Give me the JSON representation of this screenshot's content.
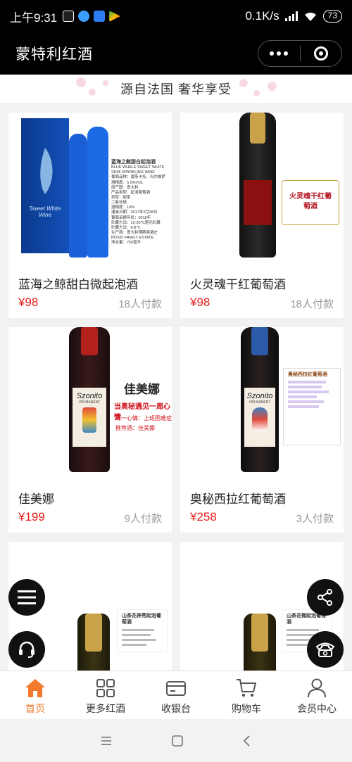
{
  "status": {
    "time": "上午9:31",
    "net": "0.1K/s",
    "battery": "73"
  },
  "navbar": {
    "title": "蒙特利红酒"
  },
  "banner": {
    "text": "源自法国 奢华享受"
  },
  "products": [
    {
      "name": "蓝海之鲸甜白微起泡酒",
      "price": "¥98",
      "sold": "18人付款"
    },
    {
      "name": "火灵魂干红葡萄酒",
      "price": "¥98",
      "sold": "18人付款"
    },
    {
      "name": "佳美娜",
      "price": "¥199",
      "sold": "9人付款"
    },
    {
      "name": "奥秘西拉红葡萄酒",
      "price": "¥258",
      "sold": "3人付款"
    },
    {
      "name": "",
      "price": "",
      "sold": ""
    },
    {
      "name": "",
      "price": "",
      "sold": ""
    }
  ],
  "image_text": {
    "p1_label_title": "蓝海之鲸甜白起泡酒",
    "p1_label_sub1": "BLUE WHALE SWEET WHITE",
    "p1_label_sub2": "SEMI SPARKLING WINE",
    "p1_label_lines": [
      "葡萄品种：莫斯卡托、玛尔维萨",
      "酒精度：5.0%VOL",
      "原产国：意大利",
      "产品类型：起泡葡萄酒",
      "类型：甜型",
      "二氧化硫",
      "酒精度：10%",
      "灌装日期：2017年2月28日",
      "葡萄采摘年份：2015年",
      "贮藏方法：12-20℃避光贮藏",
      "贮藏方法：6-8℃",
      "生产商：意大利博斯奥酒庄",
      "BOSIO FAMILY ESTATE",
      "净含量：750毫升"
    ],
    "p1_box_text": "Sweet White Wine",
    "p2_label_title": "火灵魂干红葡萄酒",
    "p3_heading": "佳美娜",
    "p3_line1": "当奥秘遇见一周心情",
    "p3_line2": "周一心情：上班困难症",
    "p3_line3": "推荐酒：佳美娜",
    "p3_bottle_brand": "Szonito",
    "p3_bottle_sub": "VIÑ MANENT",
    "p4_label_title": "奥秘西拉红葡萄酒",
    "p4_bottle_brand": "Szonito",
    "p4_bottle_sub": "VIÑ MANENT",
    "p5_label_title": "山茶花神秀起泡葡萄酒",
    "p6_label_title": "山茶花微起泡葡萄酒"
  },
  "tabs": [
    {
      "label": "首页",
      "icon": "home-icon"
    },
    {
      "label": "更多红酒",
      "icon": "grid-icon"
    },
    {
      "label": "收银台",
      "icon": "card-icon"
    },
    {
      "label": "购物车",
      "icon": "cart-icon"
    },
    {
      "label": "会员中心",
      "icon": "user-icon"
    }
  ],
  "colors": {
    "accent": "#f27a2c",
    "price": "#e8201c",
    "bar": "#000000"
  }
}
